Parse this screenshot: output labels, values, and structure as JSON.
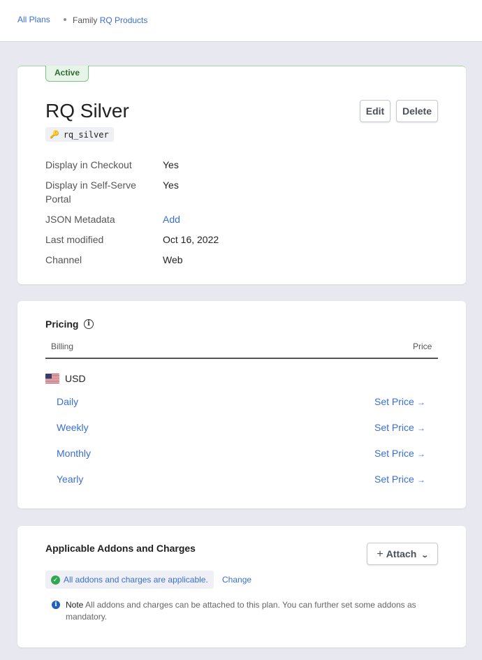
{
  "breadcrumb": {
    "all_plans": "All Plans",
    "family_prefix": "Family",
    "family_link": "RQ Products"
  },
  "plan": {
    "status": "Active",
    "name": "RQ Silver",
    "id": "rq_silver",
    "edit_label": "Edit",
    "delete_label": "Delete",
    "details": [
      {
        "label": "Display in Checkout",
        "value": "Yes"
      },
      {
        "label": "Display in Self-Serve Portal",
        "value": "Yes"
      },
      {
        "label": "JSON Metadata",
        "value": "Add"
      },
      {
        "label": "Last modified",
        "value": "Oct 16, 2022"
      },
      {
        "label": "Channel",
        "value": "Web"
      }
    ]
  },
  "pricing": {
    "title": "Pricing",
    "col_billing": "Billing",
    "col_price": "Price",
    "currency": "USD",
    "set_price_label": "Set Price",
    "periods": [
      "Daily",
      "Weekly",
      "Monthly",
      "Yearly"
    ]
  },
  "addons": {
    "title": "Applicable Addons and Charges",
    "attach_label": "Attach",
    "applicable_text": "All addons and charges are applicable.",
    "change_label": "Change",
    "note_label": "Note",
    "note_text": "All addons and charges can be attached to this plan. You can further set some addons as mandatory."
  },
  "colors": {
    "accent": "#3a6fd1",
    "success": "#31a651",
    "background": "#e8e9f0"
  },
  "icons": [
    "key-icon",
    "info-icon",
    "us-flag-icon",
    "arrow-right-icon",
    "plus-icon",
    "chevron-down-icon",
    "check-circle-icon",
    "info-circle-icon"
  ]
}
